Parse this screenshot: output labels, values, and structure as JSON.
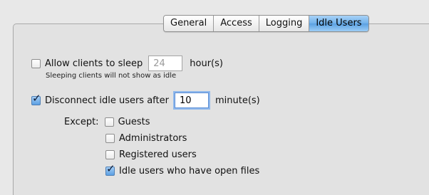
{
  "tabs": [
    {
      "label": "General",
      "selected": false
    },
    {
      "label": "Access",
      "selected": false
    },
    {
      "label": "Logging",
      "selected": false
    },
    {
      "label": "Idle Users",
      "selected": true
    }
  ],
  "sleep": {
    "label": "Allow clients to sleep",
    "checked": false,
    "value": "24",
    "unit": "hour(s)",
    "note": "Sleeping clients will not show as idle"
  },
  "disconnect": {
    "label": "Disconnect idle users after",
    "checked": true,
    "value": "10",
    "unit": "minute(s)"
  },
  "except": {
    "label": "Except:",
    "options": [
      {
        "label": "Guests",
        "checked": false
      },
      {
        "label": "Administrators",
        "checked": false
      },
      {
        "label": "Registered users",
        "checked": false
      },
      {
        "label": "Idle users who have open files",
        "checked": true
      }
    ]
  },
  "colors": {
    "accent": "#6fb0ea",
    "background": "#e8e8e8"
  }
}
